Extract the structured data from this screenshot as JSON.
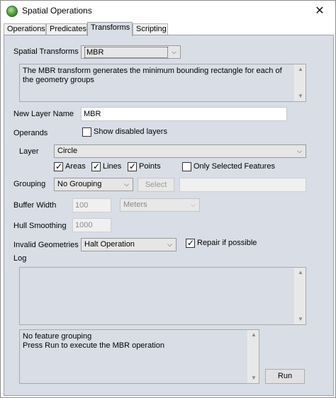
{
  "window": {
    "title": "Spatial Operations",
    "close_glyph": "✕",
    "icon": "globe-icon"
  },
  "tabs": [
    {
      "label": "Operations",
      "active": false
    },
    {
      "label": "Predicates",
      "active": false
    },
    {
      "label": "Transforms",
      "active": true
    },
    {
      "label": "Scripting",
      "active": false
    }
  ],
  "form": {
    "spatial_transforms_label": "Spatial Transforms",
    "spatial_transforms_value": "MBR",
    "description": "The MBR transform generates the minimum bounding rectangle for each of the geometry groups",
    "new_layer_name_label": "New Layer Name",
    "new_layer_name_value": "MBR",
    "operands_label": "Operands",
    "show_disabled_layers_label": "Show disabled layers",
    "show_disabled_layers_checked": false,
    "layer_label": "Layer",
    "layer_value": "Circle",
    "areas_label": "Areas",
    "areas_checked": true,
    "lines_label": "Lines",
    "lines_checked": true,
    "points_label": "Points",
    "points_checked": true,
    "only_selected_label": "Only Selected Features",
    "only_selected_checked": false,
    "grouping_label": "Grouping",
    "grouping_value": "No Grouping",
    "select_button_label": "Select",
    "grouping_field_value": "",
    "buffer_width_label": "Buffer Width",
    "buffer_width_value": "100",
    "buffer_units_value": "Meters",
    "hull_smoothing_label": "Hull Smoothing",
    "hull_smoothing_value": "1000",
    "invalid_geometries_label": "Invalid Geometries",
    "invalid_geometries_value": "Halt Operation",
    "repair_label": "Repair if possible",
    "repair_checked": true,
    "log_label": "Log",
    "log_text": "",
    "status_line1": "No feature grouping",
    "status_line2": "Press Run to execute the MBR operation",
    "run_button_label": "Run"
  },
  "glyphs": {
    "check": "✓",
    "dropdown": "⌵",
    "scroll_up": "▲",
    "scroll_down": "▼"
  }
}
